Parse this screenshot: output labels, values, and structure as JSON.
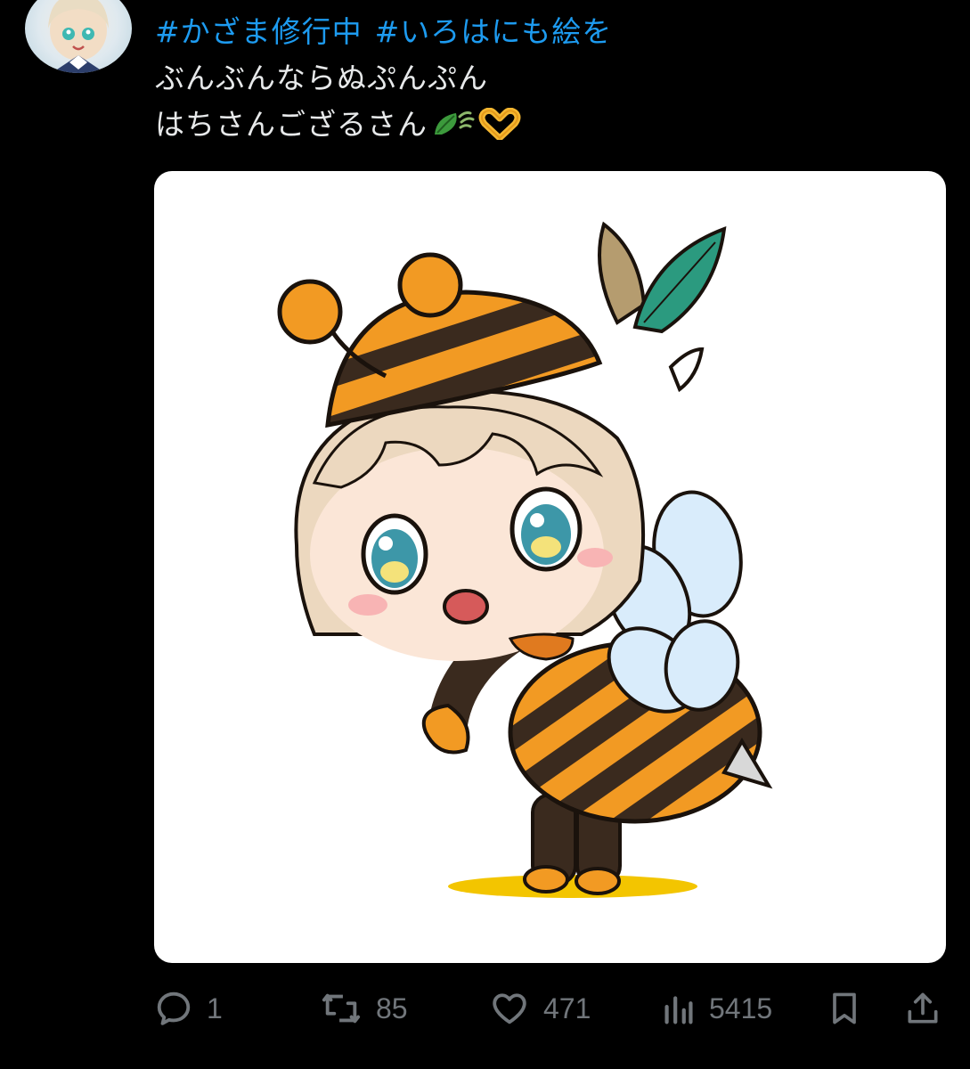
{
  "tweet": {
    "hashtags": [
      "#かざま修行中",
      "#いろはにも絵を"
    ],
    "line1": "ぶんぶんならぬぷんぷん",
    "line2": "はちさんござるさん"
  },
  "actions": {
    "reply_count": "1",
    "retweet_count": "85",
    "like_count": "471",
    "view_count": "5415"
  },
  "icons": {
    "reply": "reply-icon",
    "retweet": "retweet-icon",
    "like": "heart-icon",
    "views": "views-icon",
    "bookmark": "bookmark-icon",
    "share": "share-icon",
    "emoji_leaf": "leaf-emoji-icon",
    "emoji_heart_hands": "heart-hands-emoji-icon"
  },
  "colors": {
    "background": "#000000",
    "text": "#e7e9ea",
    "hashtag": "#1d9bf0",
    "muted": "#71767b"
  }
}
